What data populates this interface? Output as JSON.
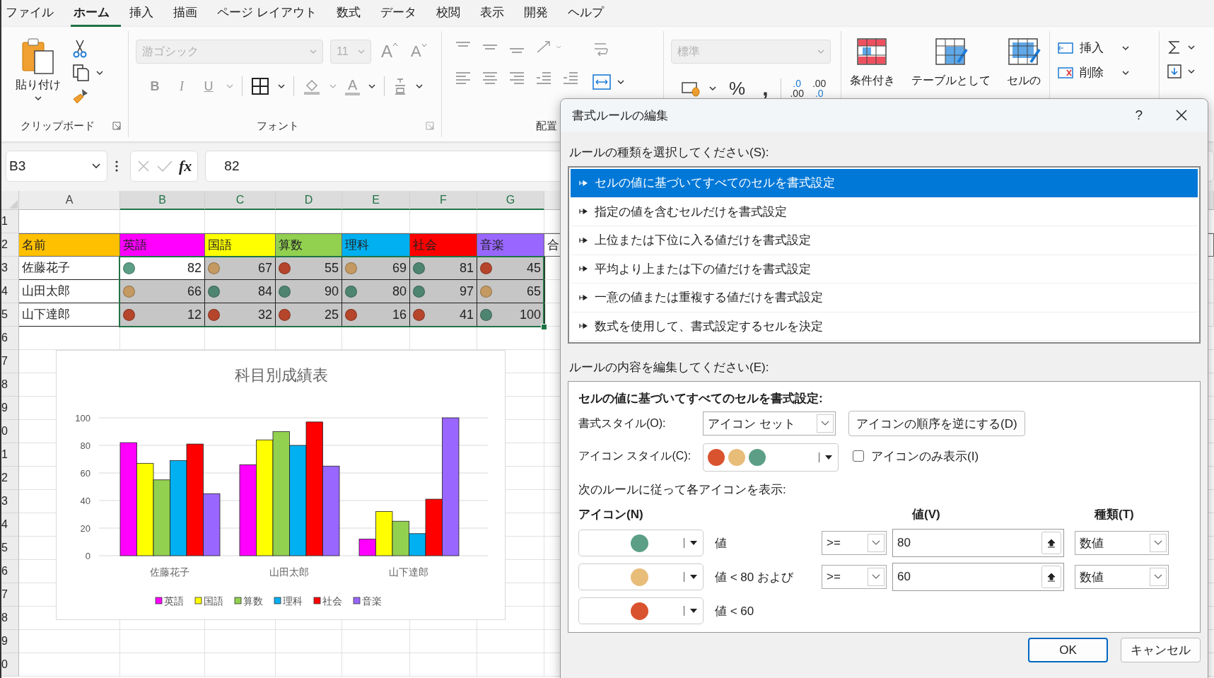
{
  "menu_tabs": [
    {
      "label": "ファイル",
      "selected": false
    },
    {
      "label": "ホーム",
      "selected": true
    },
    {
      "label": "挿入",
      "selected": false
    },
    {
      "label": "描画",
      "selected": false
    },
    {
      "label": "ページ レイアウト",
      "selected": false
    },
    {
      "label": "数式",
      "selected": false
    },
    {
      "label": "データ",
      "selected": false
    },
    {
      "label": "校閲",
      "selected": false
    },
    {
      "label": "表示",
      "selected": false
    },
    {
      "label": "開発",
      "selected": false
    },
    {
      "label": "ヘルプ",
      "selected": false
    }
  ],
  "ribbon": {
    "clipboard": {
      "paste_label": "貼り付け",
      "group_label": "クリップボード"
    },
    "font": {
      "font_name": "游ゴシック",
      "font_size": "11",
      "grow_label": "A",
      "shrink_label": "A",
      "style_buttons": [
        "B",
        "I",
        "U"
      ],
      "color_label": "A",
      "group_label": "フォント"
    },
    "alignment": {
      "group_label": "配置"
    },
    "number": {
      "format": "標準",
      "percent": "%",
      "comma": ",",
      "decimals": [
        {
          "kind": "increase",
          "top": ".0",
          "bottom": ".00"
        },
        {
          "kind": "decrease",
          "top": ".00",
          "bottom": ".0"
        }
      ]
    },
    "styles": [
      "条件付き",
      "テーブルとして",
      "セルの"
    ],
    "cells": [
      "挿入",
      "削除"
    ]
  },
  "formula_bar": {
    "name_box": "B3",
    "function_label": "fx",
    "formula": "82"
  },
  "sheet": {
    "columns": [
      {
        "label": "A",
        "selected": false
      },
      {
        "label": "B",
        "selected": true
      },
      {
        "label": "C",
        "selected": true
      },
      {
        "label": "D",
        "selected": true
      },
      {
        "label": "E",
        "selected": true
      },
      {
        "label": "F",
        "selected": true
      },
      {
        "label": "G",
        "selected": true
      }
    ],
    "row_numbers": [
      "1",
      "2",
      "3",
      "4",
      "5",
      "6",
      "7",
      "8",
      "9",
      "0",
      "1",
      "2",
      "3",
      "4",
      "5",
      "6",
      "7",
      "8",
      "9",
      "0"
    ],
    "header_row": [
      {
        "text": "名前",
        "color": "#ffc000"
      },
      {
        "text": "英語",
        "color": "#ff00ff"
      },
      {
        "text": "国語",
        "color": "#ffff00"
      },
      {
        "text": "算数",
        "color": "#92d050"
      },
      {
        "text": "理科",
        "color": "#00b0f0"
      },
      {
        "text": "社会",
        "color": "#ff0000"
      },
      {
        "text": "音楽",
        "color": "#9966ff"
      },
      {
        "text": "合",
        "color": "#ffffff"
      }
    ],
    "data_rows": [
      {
        "name": "佐藤花子",
        "cells": [
          {
            "value": "82",
            "color": "#5c9f86",
            "active": true
          },
          {
            "value": "67",
            "color": "#c49a62",
            "active": false
          },
          {
            "value": "55",
            "color": "#b5452b",
            "active": false
          },
          {
            "value": "69",
            "color": "#c49a62",
            "active": false
          },
          {
            "value": "81",
            "color": "#4e8571",
            "active": false
          },
          {
            "value": "45",
            "color": "#b5452b",
            "active": false
          }
        ]
      },
      {
        "name": "山田太郎",
        "cells": [
          {
            "value": "66",
            "color": "#c49a62",
            "active": false
          },
          {
            "value": "84",
            "color": "#4e8571",
            "active": false
          },
          {
            "value": "90",
            "color": "#4e8571",
            "active": false
          },
          {
            "value": "80",
            "color": "#4e8571",
            "active": false
          },
          {
            "value": "97",
            "color": "#4e8571",
            "active": false
          },
          {
            "value": "65",
            "color": "#c49a62",
            "active": false
          }
        ]
      },
      {
        "name": "山下達郎",
        "cells": [
          {
            "value": "12",
            "color": "#b5452b",
            "active": false
          },
          {
            "value": "32",
            "color": "#b5452b",
            "active": false
          },
          {
            "value": "25",
            "color": "#b5452b",
            "active": false
          },
          {
            "value": "16",
            "color": "#b5452b",
            "active": false
          },
          {
            "value": "41",
            "color": "#b5452b",
            "active": false
          },
          {
            "value": "100",
            "color": "#4e8571",
            "active": false
          }
        ]
      }
    ]
  },
  "chart": {
    "chart_data": {
      "type": "bar",
      "title": "科目別成績表",
      "categories": [
        "佐藤花子",
        "山田太郎",
        "山下達郎"
      ],
      "series": [
        {
          "name": "英語",
          "color": "#ff00ff",
          "values": [
            82,
            66,
            12
          ]
        },
        {
          "name": "国語",
          "color": "#ffff00",
          "values": [
            67,
            84,
            32
          ]
        },
        {
          "name": "算数",
          "color": "#92d050",
          "values": [
            55,
            90,
            25
          ]
        },
        {
          "name": "理科",
          "color": "#00b0f0",
          "values": [
            69,
            80,
            16
          ]
        },
        {
          "name": "社会",
          "color": "#ff0000",
          "values": [
            81,
            97,
            41
          ]
        },
        {
          "name": "音楽",
          "color": "#9966ff",
          "values": [
            45,
            65,
            100
          ]
        }
      ],
      "ylim": [
        0,
        100
      ],
      "yticks": [
        0,
        20,
        40,
        60,
        80,
        100
      ],
      "legend": "bottom",
      "grid": true
    }
  },
  "dialog": {
    "title": "書式ルールの編集",
    "help": "?",
    "rule_type_label": "ルールの種類を選択してください(S):",
    "rule_types": [
      {
        "label": "セルの値に基づいてすべてのセルを書式設定",
        "selected": true
      },
      {
        "label": "指定の値を含むセルだけを書式設定",
        "selected": false
      },
      {
        "label": "上位または下位に入る値だけを書式設定",
        "selected": false
      },
      {
        "label": "平均より上または下の値だけを書式設定",
        "selected": false
      },
      {
        "label": "一意の値または重複する値だけを書式設定",
        "selected": false
      },
      {
        "label": "数式を使用して、書式設定するセルを決定",
        "selected": false
      }
    ],
    "edit_label": "ルールの内容を編集してください(E):",
    "description": "セルの値に基づいてすべてのセルを書式設定:",
    "format_style_label": "書式スタイル(O):",
    "format_style": "アイコン セット",
    "reverse_button": "アイコンの順序を逆にする(D)",
    "icon_style_label": "アイコン スタイル(C):",
    "icon_style": [
      {
        "color": "#d9532f"
      },
      {
        "color": "#e8bd7a"
      },
      {
        "color": "#5c9f86"
      }
    ],
    "icon_only": {
      "label": "アイコンのみ表示(I)",
      "checked": false
    },
    "rules_label": "次のルールに従って各アイコンを表示:",
    "column_headers": [
      "アイコン(N)",
      "値(V)",
      "種類(T)"
    ],
    "icon_rules": [
      {
        "color": "#5c9f86",
        "condition": "値",
        "operator": ">=",
        "value": "80",
        "type": "数値"
      },
      {
        "color": "#e8bd7a",
        "condition": "値 < 80 および",
        "operator": ">=",
        "value": "60",
        "type": "数値"
      },
      {
        "color": "#d9532f",
        "condition": "値 < 60"
      }
    ],
    "buttons": [
      {
        "label": "OK",
        "selected": true
      },
      {
        "label": "キャンセル",
        "selected": false
      }
    ]
  }
}
